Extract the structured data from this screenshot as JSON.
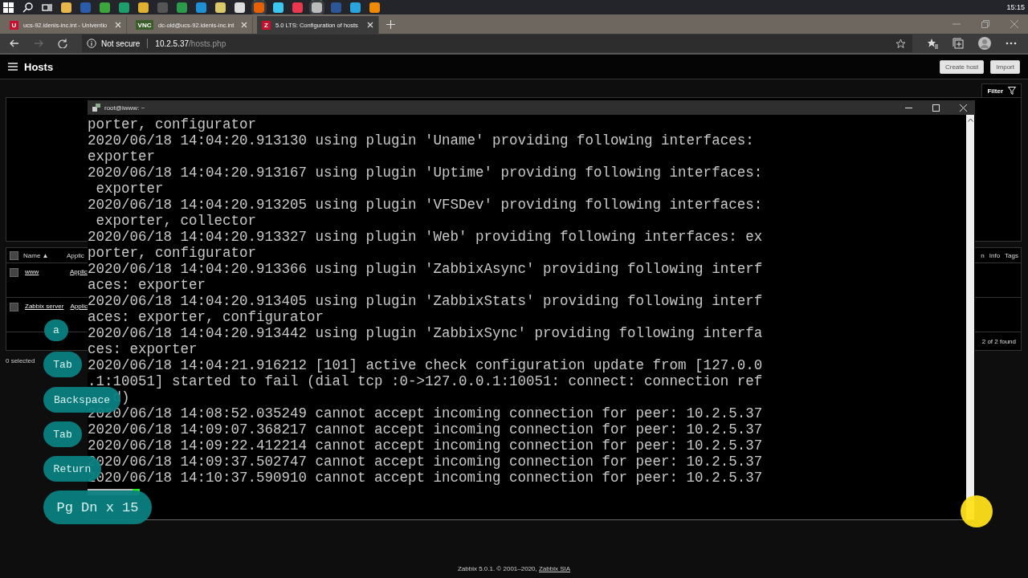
{
  "taskbar": {
    "clock": "15:15"
  },
  "browser": {
    "tabs": [
      {
        "badge": "U",
        "title": "ucs-92.idenis-inc.int - Univentio",
        "selected": false
      },
      {
        "badge": "VNC",
        "title": "dc-old@ucs-92.idenis-inc.int",
        "selected": false
      },
      {
        "badge": "Z",
        "title": "5.0 LTS: Configuration of hosts",
        "selected": true
      }
    ],
    "security": "Not secure",
    "url_host": "10.2.5.37",
    "url_path": "/hosts.php"
  },
  "page": {
    "title": "Hosts",
    "buttons": [
      "Create host",
      "Import"
    ],
    "filter_tab": "Filter",
    "table": {
      "all_checked": false,
      "columns": [
        "Name ▲",
        "Applic",
        "n",
        "Info",
        "Tags"
      ],
      "rows": [
        {
          "checked": false,
          "name": "www",
          "column_2": "Applic"
        },
        {
          "checked": false,
          "name": "Zabbix server",
          "column_2": "Applic"
        }
      ],
      "found": "2 of 2 found"
    },
    "selected_count": "0 selected",
    "footer": {
      "text": "Zabbix 5.0.1. © 2001–2020, ",
      "link": "Zabbix SIA"
    }
  },
  "terminal": {
    "title": "root@iwww: ~",
    "lines": [
      "porter, configurator",
      "2020/06/18 14:04:20.913130 using plugin 'Uname' providing following interfaces:",
      "exporter",
      "2020/06/18 14:04:20.913167 using plugin 'Uptime' providing following interfaces:",
      " exporter",
      "2020/06/18 14:04:20.913205 using plugin 'VFSDev' providing following interfaces:",
      " exporter, collector",
      "2020/06/18 14:04:20.913327 using plugin 'Web' providing following interfaces: ex",
      "porter, configurator",
      "2020/06/18 14:04:20.913366 using plugin 'ZabbixAsync' providing following interf",
      "aces: exporter",
      "2020/06/18 14:04:20.913405 using plugin 'ZabbixStats' providing following interf",
      "aces: exporter, configurator",
      "2020/06/18 14:04:20.913442 using plugin 'ZabbixSync' providing following interfa",
      "ces: exporter",
      "2020/06/18 14:04:21.916212 [101] active check configuration update from [127.0.0",
      ".1:10051] started to fail (dial tcp :0->127.0.0.1:10051: connect: connection ref",
      "   d)",
      "2020/06/18 14:08:52.035249 cannot accept incoming connection for peer: 10.2.5.37",
      "2020/06/18 14:09:07.368217 cannot accept incoming connection for peer: 10.2.5.37",
      "2020/06/18 14:09:22.412214 cannot accept incoming connection for peer: 10.2.5.37",
      "2020/06/18 14:09:37.502747 cannot accept incoming connection for peer: 10.2.5.37",
      "2020/06/18 14:10:37.590910 cannot accept incoming connection for peer: 10.2.5.37"
    ]
  },
  "keystrokes": [
    {
      "label": "a"
    },
    {
      "label": "Tab"
    },
    {
      "label": "Backspace"
    },
    {
      "label": "Tab"
    },
    {
      "label": "Return"
    },
    {
      "label": "Pg Dn x 15"
    }
  ]
}
